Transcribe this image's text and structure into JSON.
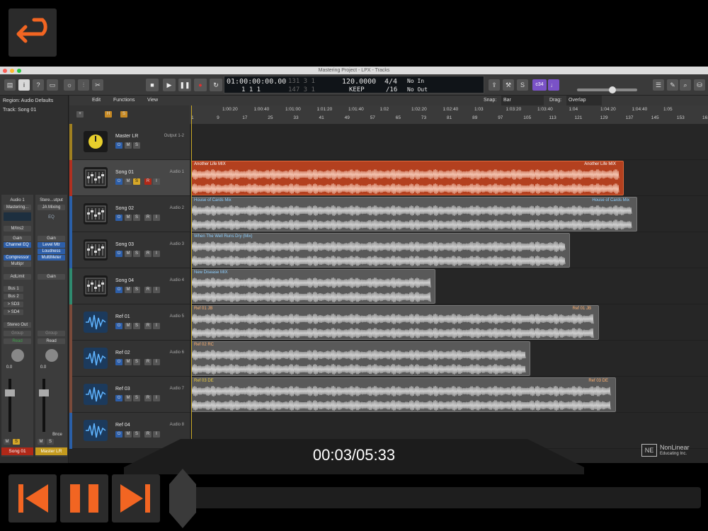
{
  "window": {
    "title": "Mastering Project - LPX - Tracks"
  },
  "lcd": {
    "time": "01:00:00:00.00",
    "bars_top": "131  3  1",
    "bars_bottom": "1  1  1",
    "bars2_bottom": "147  3  1",
    "tempo": "120.0000",
    "tempo_mode": "KEEP",
    "sig": "4/4",
    "div": "/16",
    "in": "No In",
    "out": "No Out"
  },
  "badge": "c34",
  "inspector": {
    "region": "Region: Audio Defaults",
    "track": "Track: Song 01",
    "strip1": {
      "io": "Audio 1",
      "setting": "Mastering...",
      "mono": "M/Ins2",
      "eq": "Gain",
      "plugins": [
        "Channel EQ",
        "Compressor",
        "Multipr"
      ],
      "limit": "AdLimit",
      "sends": [
        "Bus 1",
        "Bus 2",
        "> SD3",
        "> SD4"
      ],
      "output": "Stereo Out",
      "group": "Group",
      "auto": "Read",
      "pan_val": "0.0",
      "name": "Song 01"
    },
    "strip2": {
      "io": "Stere...utput",
      "setting": "JA Mixing",
      "eq": "EQ",
      "gain": "Gain",
      "plugins": [
        "Level Mtr",
        "Loudness",
        "MultiMeter"
      ],
      "gain2": "Gain",
      "group": "Group",
      "auto": "Read",
      "pan_val": "0.0",
      "bnce": "Bnce",
      "name": "Master LR"
    }
  },
  "localbar": {
    "edit": "Edit",
    "functions": "Functions",
    "view": "View",
    "snap_label": "Snap:",
    "snap_value": "Bar",
    "drag_label": "Drag:",
    "drag_value": "Overlap"
  },
  "ruler": {
    "times": [
      "1:00:20",
      "1:00:40",
      "1:01:00",
      "1:01:20",
      "1:01:40",
      "1:02",
      "1:02:20",
      "1:02:40",
      "1:03",
      "1:03:20",
      "1:03:40",
      "1:04",
      "1:04:20",
      "1:04:40",
      "1:05"
    ],
    "bars": [
      "1",
      "9",
      "17",
      "25",
      "33",
      "41",
      "49",
      "57",
      "65",
      "73",
      "81",
      "89",
      "97",
      "105",
      "113",
      "121",
      "129",
      "137",
      "145",
      "153",
      "161"
    ]
  },
  "tracks": [
    {
      "name": "Master LR",
      "out": "Output 1-2"
    },
    {
      "name": "Song 01",
      "out": "Audio 1"
    },
    {
      "name": "Song 02",
      "out": "Audio 2"
    },
    {
      "name": "Song 03",
      "out": "Audio 3"
    },
    {
      "name": "Song 04",
      "out": "Audio 4"
    },
    {
      "name": "Ref 01",
      "out": "Audio 5"
    },
    {
      "name": "Ref 02",
      "out": "Audio 6"
    },
    {
      "name": "Ref 03",
      "out": "Audio 7"
    },
    {
      "name": "Ref 04",
      "out": "Audio 8"
    }
  ],
  "regions": [
    {
      "name": "Another Life MIX",
      "end_name": "Another Life MIX"
    },
    {
      "name": "House of Cards Mix",
      "end_name": "House of Cards Mix"
    },
    {
      "name": "When The Well Runs Dry (Mix)",
      "end_name": ""
    },
    {
      "name": "New Disease MIX",
      "end_name": ""
    },
    {
      "name": "Ref 01 JB",
      "end_name": "Ref 01 JB"
    },
    {
      "name": "Ref 02 RC",
      "end_name": ""
    },
    {
      "name": "Ref 03 DE",
      "end_name": "Ref 03 DE"
    }
  ],
  "player": {
    "time": "00:03/05:33",
    "progress": 0.009,
    "logo_line1": "NonLinear",
    "logo_line2": "Educating Inc."
  }
}
